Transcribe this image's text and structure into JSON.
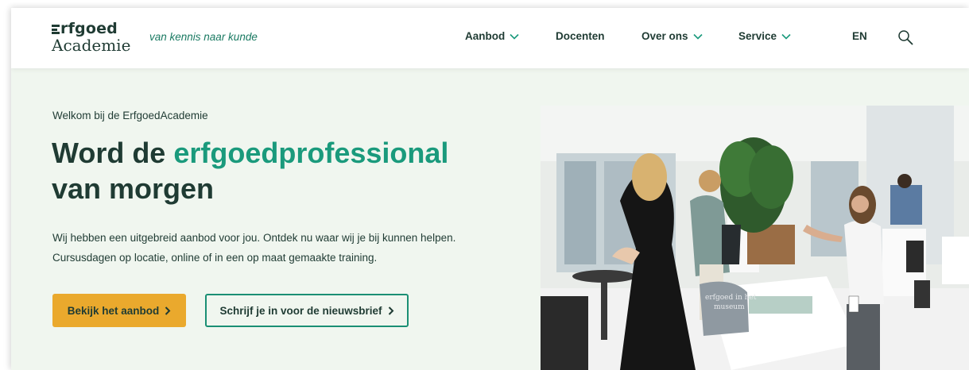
{
  "header": {
    "logo_line1": "rfgoed",
    "logo_line2": "Academie",
    "tagline": "van kennis naar kunde",
    "nav": [
      {
        "label": "Aanbod",
        "dropdown": true
      },
      {
        "label": "Docenten",
        "dropdown": false
      },
      {
        "label": "Over ons",
        "dropdown": true
      },
      {
        "label": "Service",
        "dropdown": true
      }
    ],
    "lang_label": "EN",
    "search_icon": "search-icon"
  },
  "hero": {
    "kicker": "Welkom bij de ErfgoedAcademie",
    "headline_part1": "Word de ",
    "headline_accent": "erfgoedprofessional",
    "headline_part2": "van morgen",
    "lede_line1": "Wij hebben een uitgebreid aanbod voor jou. Ontdek nu waar wij je bij kunnen helpen.",
    "lede_line2": "Cursusdagen op locatie, online of in een op maat gemaakte training.",
    "primary_cta": "Bekijk het aanbod",
    "secondary_cta": "Schrijf je in voor de nieuwsbrief",
    "photo_bag_text_line1": "erfgoed in het",
    "photo_bag_text_line2": "museum"
  },
  "colors": {
    "dark_green": "#1f3b33",
    "accent_green": "#1a9a7c",
    "cta_yellow": "#eaa92d",
    "hero_bg": "#f0f6ef"
  }
}
